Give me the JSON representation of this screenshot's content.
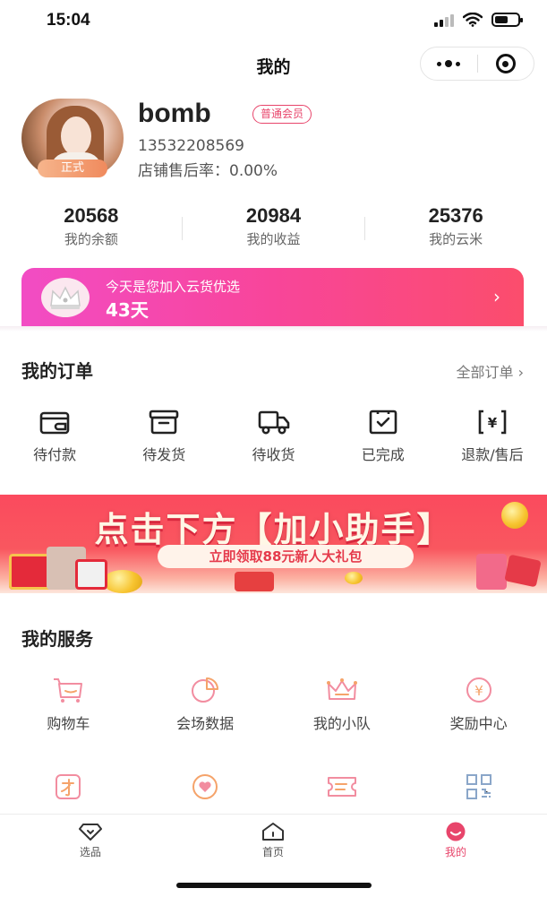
{
  "status_bar": {
    "time": "15:04"
  },
  "nav": {
    "title": "我的"
  },
  "profile": {
    "username": "bomb",
    "member_level": "普通会员",
    "avatar_badge": "正式",
    "phone": "13532208569",
    "after_sales_rate": "店铺售后率：0.00%"
  },
  "stats": [
    {
      "value": "20568",
      "label": "我的余额"
    },
    {
      "value": "20984",
      "label": "我的收益"
    },
    {
      "value": "25376",
      "label": "我的云米"
    }
  ],
  "join_banner": {
    "text": "今天是您加入云货优选",
    "days": "43天",
    "arrow": "›"
  },
  "orders": {
    "title": "我的订单",
    "all_link": "全部订单 ›",
    "items": [
      {
        "label": "待付款",
        "icon": "wallet-icon"
      },
      {
        "label": "待发货",
        "icon": "box-icon"
      },
      {
        "label": "待收货",
        "icon": "truck-icon"
      },
      {
        "label": "已完成",
        "icon": "checklist-icon"
      },
      {
        "label": "退款/售后",
        "icon": "refund-icon"
      }
    ]
  },
  "promo": {
    "headline": "点击下方【加小助手】",
    "subline": "立即领取88元新人大礼包"
  },
  "services": {
    "title": "我的服务",
    "items": [
      {
        "label": "购物车",
        "icon": "cart-icon"
      },
      {
        "label": "会场数据",
        "icon": "pie-chart-icon"
      },
      {
        "label": "我的小队",
        "icon": "crown-icon"
      },
      {
        "label": "奖励中心",
        "icon": "yen-coin-icon"
      }
    ],
    "row2_icons": [
      "talent-icon",
      "heart-icon",
      "ticket-icon",
      "qrcode-icon"
    ]
  },
  "tabbar": {
    "items": [
      {
        "label": "选品",
        "icon": "diamond-icon"
      },
      {
        "label": "首页",
        "icon": "home-icon"
      },
      {
        "label": "我的",
        "icon": "profile-smile-icon",
        "active": true
      }
    ]
  },
  "colors": {
    "accent": "#e8456b",
    "icon_pink": "#f28da0",
    "icon_orange": "#f5a36a"
  }
}
